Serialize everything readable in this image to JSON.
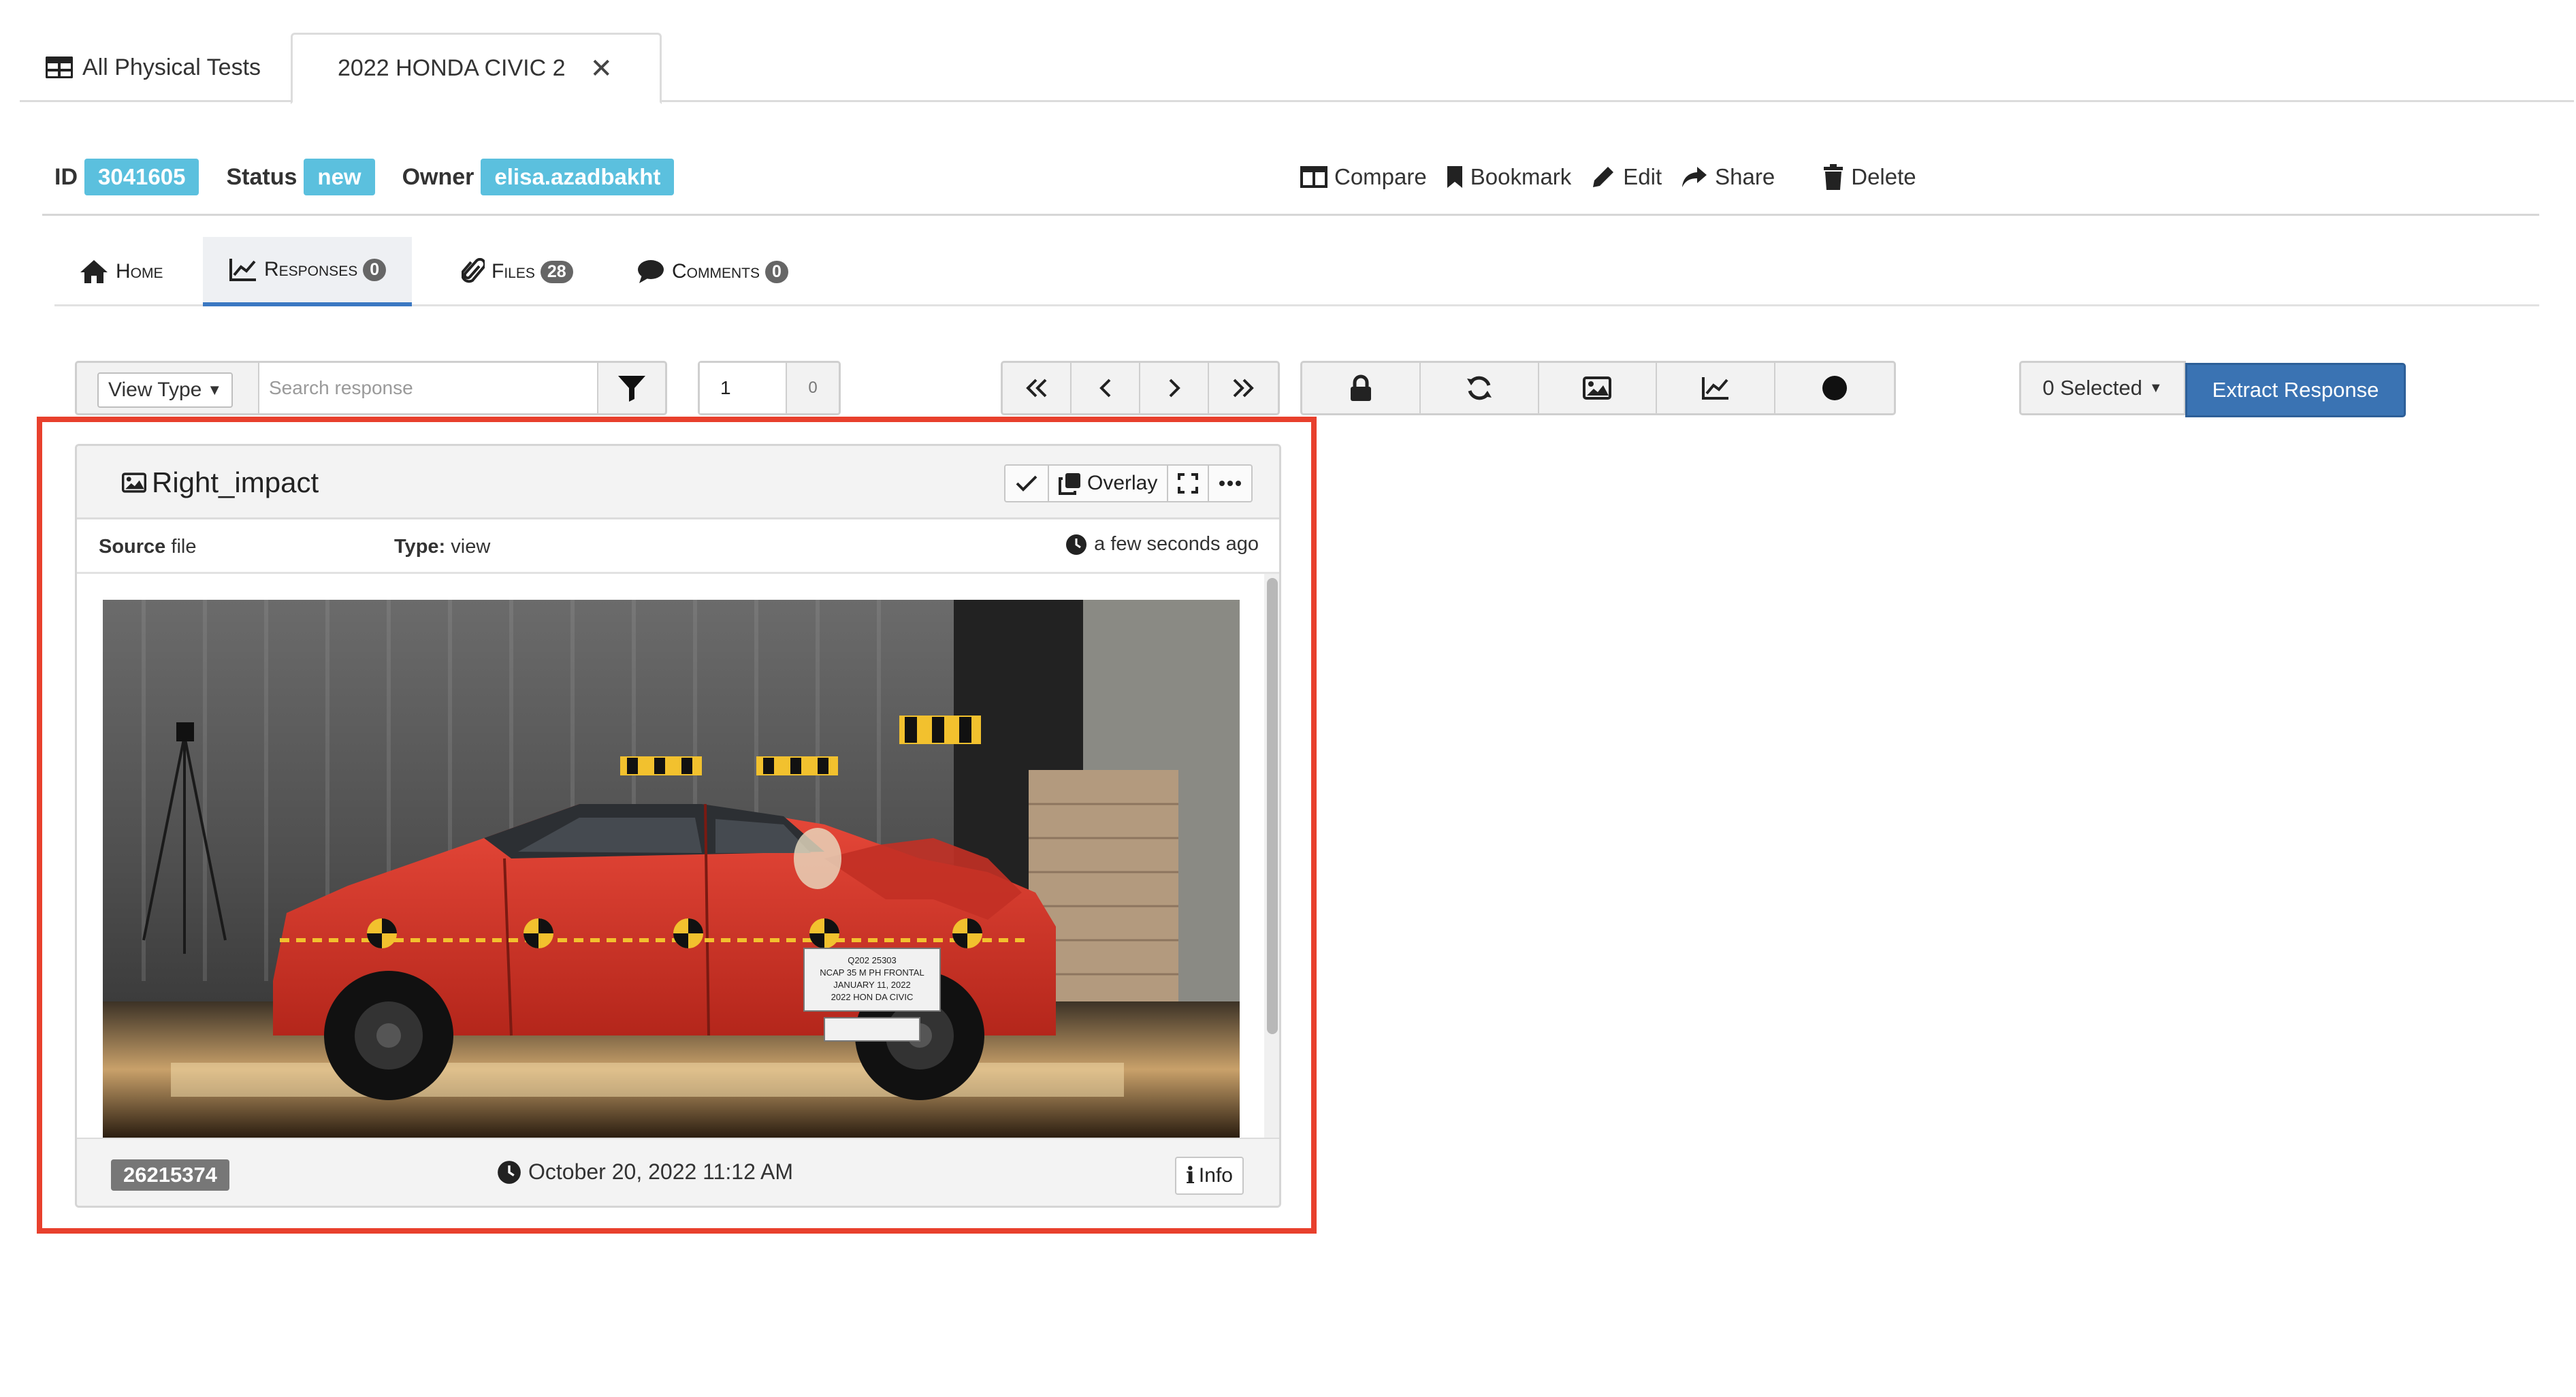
{
  "top_tabs": {
    "all_label": "All Physical Tests",
    "active_label": "2022 HONDA CIVIC 2",
    "close_glyph": "✕"
  },
  "meta": {
    "id_label": "ID",
    "id_value": "3041605",
    "status_label": "Status",
    "status_value": "new",
    "owner_label": "Owner",
    "owner_value": "elisa.azadbakht",
    "badge_color": "#5bc0de"
  },
  "actions": {
    "compare": "Compare",
    "bookmark": "Bookmark",
    "edit": "Edit",
    "share": "Share",
    "delete": "Delete"
  },
  "inner_tabs": {
    "home": "Home",
    "responses": "Responses",
    "responses_count": "0",
    "files": "Files",
    "files_count": "28",
    "comments": "Comments",
    "comments_count": "0",
    "active": "responses"
  },
  "toolbar": {
    "view_type_label": "View Type",
    "search_placeholder": "Search response",
    "page_value": "1",
    "page_total": "0",
    "selected_label": "0 Selected",
    "extract_label": "Extract Response",
    "accent_color": "#3a73b3"
  },
  "card": {
    "title": "Right_impact",
    "overlay_label": "Overlay",
    "source_label": "Source",
    "source_value": "file",
    "type_label": "Type:",
    "type_value": "view",
    "time_ago": "a few seconds ago",
    "footer_id": "26215374",
    "footer_date": "October 20, 2022 11:12 AM",
    "info_label": "Info",
    "highlight_color": "#e8402d"
  },
  "photo": {
    "placard_lines": [
      "Q202 25303",
      "NCAP 35 M PH FRONTAL",
      "JANUARY 11, 2022",
      "2022 HON DA CIVIC"
    ]
  }
}
